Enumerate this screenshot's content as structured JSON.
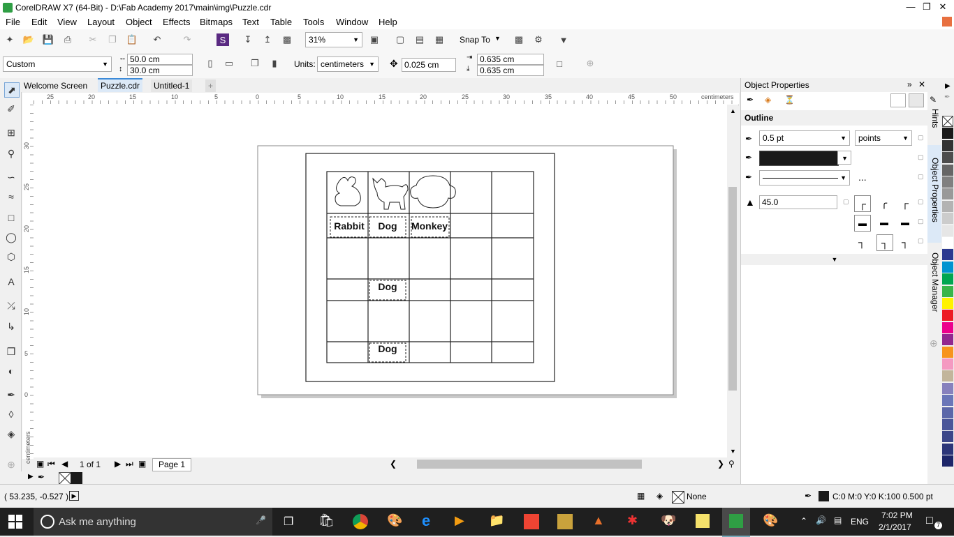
{
  "window": {
    "title": "CorelDRAW X7 (64-Bit) - D:\\Fab Academy 2017\\main\\img\\Puzzle.cdr"
  },
  "menu": [
    "File",
    "Edit",
    "View",
    "Layout",
    "Object",
    "Effects",
    "Bitmaps",
    "Text",
    "Table",
    "Tools",
    "Window",
    "Help"
  ],
  "toolbar": {
    "zoom": "31%",
    "snap_to": "Snap To"
  },
  "property_bar": {
    "page_preset": "Custom",
    "width": "50.0 cm",
    "height": "30.0 cm",
    "units_label": "Units:",
    "units": "centimeters",
    "nudge": "0.025 cm",
    "dup_x": "0.635 cm",
    "dup_y": "0.635 cm"
  },
  "tabs": [
    "Welcome Screen",
    "Puzzle.cdr",
    "Untitled-1"
  ],
  "ruler": {
    "unit": "centimeters",
    "h_ticks": [
      "25",
      "20",
      "15",
      "10",
      "5",
      "0",
      "5",
      "10",
      "15",
      "20",
      "25",
      "30",
      "35",
      "40",
      "45",
      "50"
    ],
    "v_ticks": [
      "30",
      "25",
      "20",
      "15",
      "10",
      "5",
      "0"
    ]
  },
  "drawing": {
    "row_labels": [
      "Rabbit",
      "Dog",
      "Monkey"
    ],
    "dog_labels": [
      "Dog",
      "Dog"
    ]
  },
  "page_nav": {
    "counter": "1 of 1",
    "page_tab": "Page 1"
  },
  "status": {
    "coords": "( 53.235, -0.527 )",
    "fill": "None",
    "outline": "C:0 M:0 Y:0 K:100  0.500 pt"
  },
  "object_properties": {
    "title": "Object Properties",
    "section": "Outline",
    "width": "0.5 pt",
    "units": "points",
    "miter": "45.0",
    "ellipsis": "..."
  },
  "side_tabs": [
    "Hints",
    "Object Properties",
    "Object Manager"
  ],
  "palette_colors": [
    "#ffffff",
    "#1a1a1a",
    "#333333",
    "#4d4d4d",
    "#666666",
    "#808080",
    "#999999",
    "#b3b3b3",
    "#cccccc",
    "#e6e6e6",
    "#ffffff",
    "#2b3990",
    "#0093d0",
    "#00a651",
    "#39b54a",
    "#fff200",
    "#ed1c24",
    "#ec008c",
    "#92278f",
    "#f7941d",
    "#f49ac1",
    "#c2b59b",
    "#8781bd",
    "#6a76b8",
    "#5b67a9",
    "#4a5699",
    "#3b4689",
    "#2c3679",
    "#1d2669"
  ],
  "taskbar": {
    "search_placeholder": "Ask me anything",
    "lang": "ENG",
    "time": "7:02 PM",
    "date": "2/1/2017",
    "notif_count": "7"
  }
}
